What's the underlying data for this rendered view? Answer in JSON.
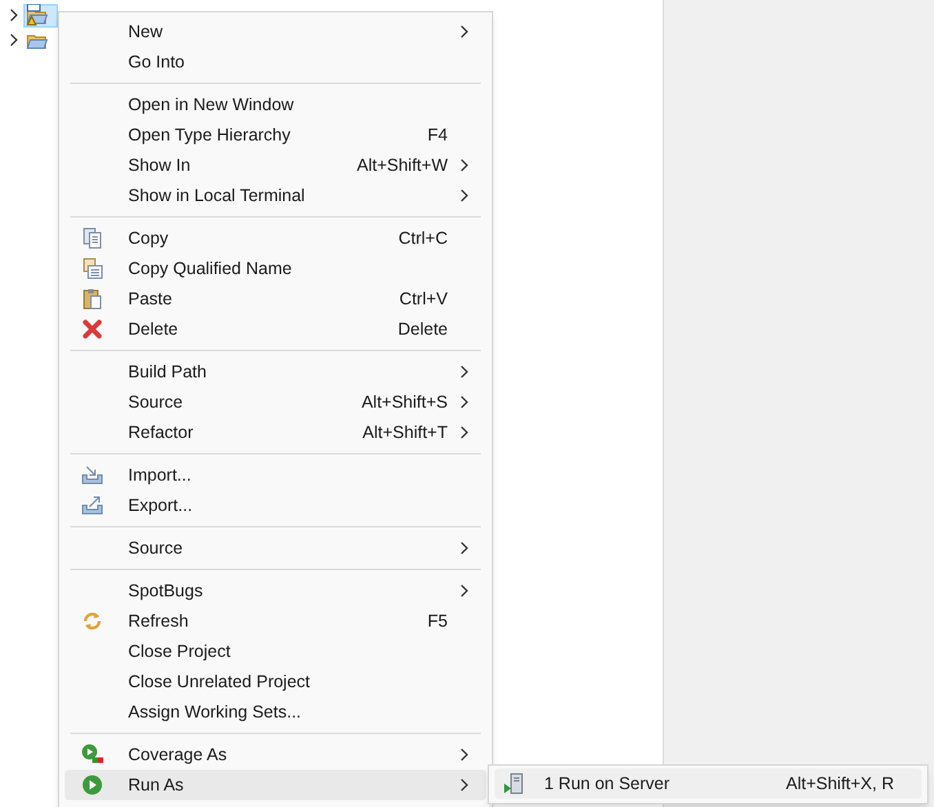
{
  "tree": [
    {
      "selected": true,
      "kind": "project"
    },
    {
      "selected": false,
      "kind": "folder"
    }
  ],
  "context_menu": {
    "groups": [
      [
        {
          "label": "New",
          "has_submenu": true,
          "selected": false
        },
        {
          "label": "Go Into",
          "has_submenu": false,
          "selected": false
        }
      ],
      [
        {
          "label": "Open in New Window",
          "has_submenu": false,
          "selected": false
        },
        {
          "label": "Open Type Hierarchy",
          "shortcut": "F4",
          "has_submenu": false,
          "selected": false
        },
        {
          "label": "Show In",
          "shortcut": "Alt+Shift+W",
          "has_submenu": true,
          "selected": false
        },
        {
          "label": "Show in Local Terminal",
          "has_submenu": true,
          "selected": false
        }
      ],
      [
        {
          "label": "Copy",
          "shortcut": "Ctrl+C",
          "kind": "copy",
          "has_submenu": false,
          "selected": false
        },
        {
          "label": "Copy Qualified Name",
          "kind": "copy-name",
          "has_submenu": false,
          "selected": false
        },
        {
          "label": "Paste",
          "shortcut": "Ctrl+V",
          "kind": "paste",
          "has_submenu": false,
          "selected": false
        },
        {
          "label": "Delete",
          "shortcut": "Delete",
          "kind": "delete",
          "has_submenu": false,
          "selected": false
        }
      ],
      [
        {
          "label": "Build Path",
          "has_submenu": true,
          "selected": false
        },
        {
          "label": "Source",
          "shortcut": "Alt+Shift+S",
          "has_submenu": true,
          "selected": false
        },
        {
          "label": "Refactor",
          "shortcut": "Alt+Shift+T",
          "has_submenu": true,
          "selected": false
        }
      ],
      [
        {
          "label": "Import...",
          "kind": "import",
          "has_submenu": false,
          "selected": false
        },
        {
          "label": "Export...",
          "kind": "export",
          "has_submenu": false,
          "selected": false
        }
      ],
      [
        {
          "label": "Source",
          "has_submenu": true,
          "selected": false
        }
      ],
      [
        {
          "label": "SpotBugs",
          "has_submenu": true,
          "selected": false
        },
        {
          "label": "Refresh",
          "shortcut": "F5",
          "kind": "refresh",
          "has_submenu": false,
          "selected": false
        },
        {
          "label": "Close Project",
          "has_submenu": false,
          "selected": false
        },
        {
          "label": "Close Unrelated Project",
          "has_submenu": false,
          "selected": false
        },
        {
          "label": "Assign Working Sets...",
          "has_submenu": false,
          "selected": false
        }
      ],
      [
        {
          "label": "Coverage As",
          "kind": "coverage",
          "has_submenu": true,
          "selected": false
        },
        {
          "label": "Run As",
          "kind": "run",
          "has_submenu": true,
          "selected": true
        }
      ]
    ]
  },
  "submenu": {
    "items": [
      {
        "label": "1 Run on Server",
        "shortcut": "Alt+Shift+X, R",
        "kind": "server",
        "selected": false
      }
    ]
  }
}
